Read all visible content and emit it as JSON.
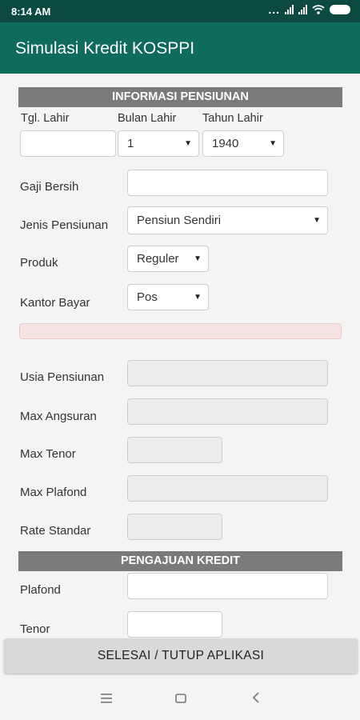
{
  "status_bar": {
    "time": "8:14 AM",
    "dots": "...",
    "colors": {
      "bar": "#0b4a3f"
    }
  },
  "app_bar": {
    "title": "Simulasi Kredit KOSPPI",
    "color": "#0f6b5a"
  },
  "informasi_pensiunan": {
    "header": "INFORMASI PENSIUNAN",
    "tgl_lahir": {
      "label": "Tgl. Lahir",
      "value": ""
    },
    "bulan_lahir": {
      "label": "Bulan Lahir",
      "value": "1"
    },
    "tahun_lahir": {
      "label": "Tahun Lahir",
      "value": "1940"
    },
    "gaji_bersih": {
      "label": "Gaji Bersih",
      "value": ""
    },
    "jenis_pensiunan": {
      "label": "Jenis Pensiunan",
      "value": "Pensiun Sendiri"
    },
    "produk": {
      "label": "Produk",
      "value": "Reguler"
    },
    "kantor_bayar": {
      "label": "Kantor Bayar",
      "value": "Pos"
    }
  },
  "hasil": {
    "usia_pensiunan": {
      "label": "Usia Pensiunan",
      "value": ""
    },
    "max_angsuran": {
      "label": "Max Angsuran",
      "value": ""
    },
    "max_tenor": {
      "label": "Max Tenor",
      "value": ""
    },
    "max_plafond": {
      "label": "Max Plafond",
      "value": ""
    },
    "rate_standar": {
      "label": "Rate Standar",
      "value": ""
    }
  },
  "pengajuan_kredit": {
    "header": "PENGAJUAN KREDIT",
    "plafond": {
      "label": "Plafond",
      "value": ""
    },
    "tenor": {
      "label": "Tenor",
      "value": ""
    }
  },
  "footer": {
    "button": "SELESAI / TUTUP APLIKASI"
  },
  "nav_bar": {
    "menu_icon": "menu-icon",
    "home_icon": "home-icon",
    "back_icon": "back-icon"
  }
}
